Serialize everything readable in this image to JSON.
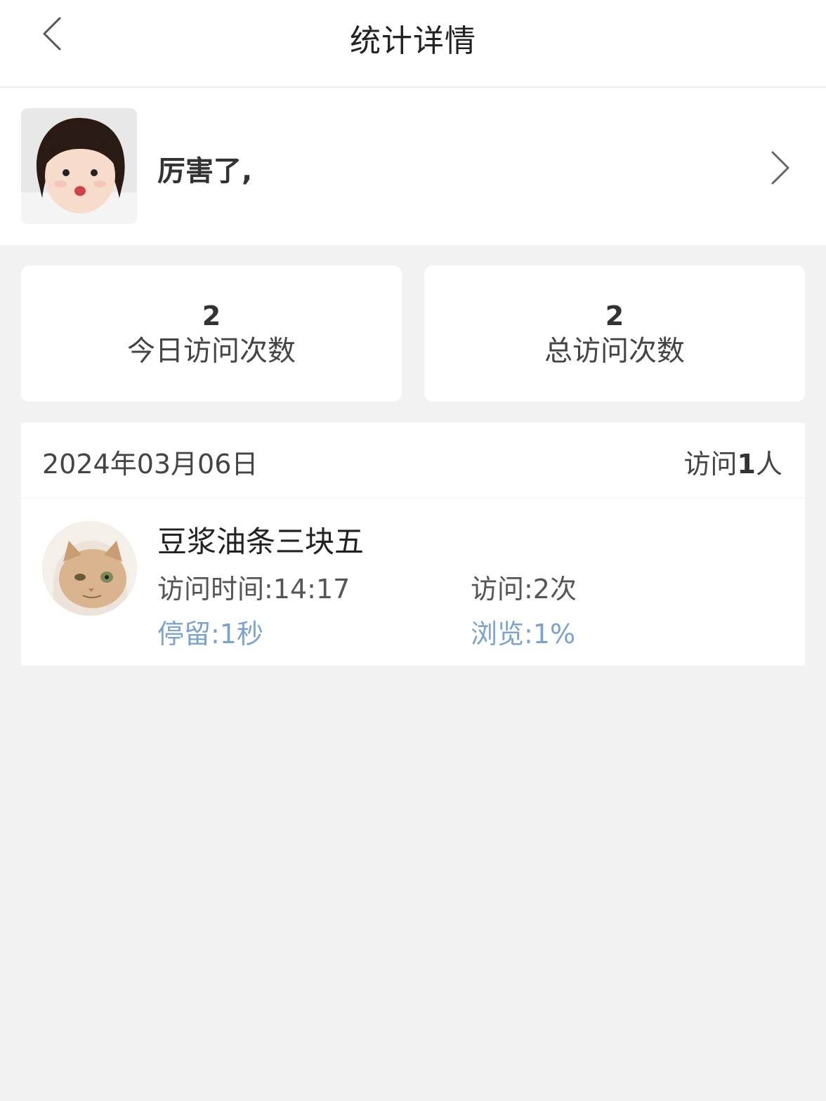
{
  "header": {
    "title": "统计详情"
  },
  "profile": {
    "name": "厉害了,"
  },
  "stats": [
    {
      "value": "2",
      "label": "今日访问次数"
    },
    {
      "value": "2",
      "label": "总访问次数"
    }
  ],
  "visits": {
    "date": "2024年03月06日",
    "count_prefix": "访问",
    "count_value": "1",
    "count_suffix": "人",
    "visitor": {
      "name": "豆浆油条三块五",
      "visit_time": "访问时间:14:17",
      "visit_times": "访问:2次",
      "stay": "停留:1秒",
      "browse": "浏览:1%"
    }
  },
  "colors": {
    "accent_blue": "#7aa3cf",
    "background": "#f2f2f2"
  },
  "icons": {
    "back": "chevron-left-icon",
    "forward": "chevron-right-icon"
  }
}
